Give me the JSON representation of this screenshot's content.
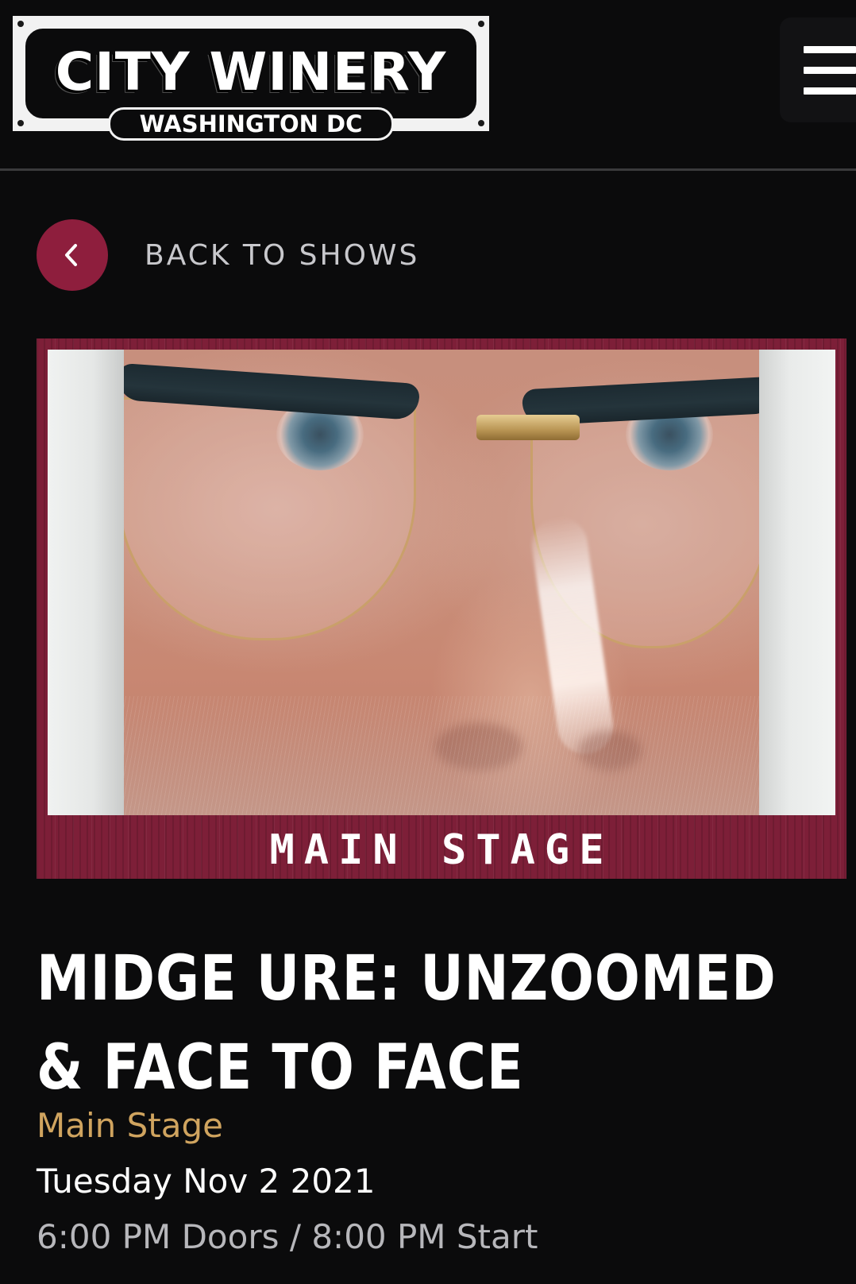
{
  "header": {
    "logo_name": "CITY WINERY",
    "logo_location": "WASHINGTON DC",
    "menu_icon": "hamburger-menu-icon"
  },
  "nav": {
    "back_label": "BACK TO SHOWS",
    "back_icon": "chevron-left-icon"
  },
  "hero": {
    "image_description_icon": "event-photo",
    "stage_banner": "MAIN STAGE"
  },
  "event": {
    "title": "MIDGE URE: UNZOOMED & FACE TO FACE",
    "venue": "Main Stage",
    "date": "Tuesday Nov 2 2021",
    "times": "6:00 PM Doors / 8:00 PM Start"
  },
  "colors": {
    "background": "#0b0b0c",
    "accent": "#8e1e3d",
    "venue_text": "#d0a45f",
    "times_text": "#b7b7bb",
    "banner": "#7d1f38"
  }
}
